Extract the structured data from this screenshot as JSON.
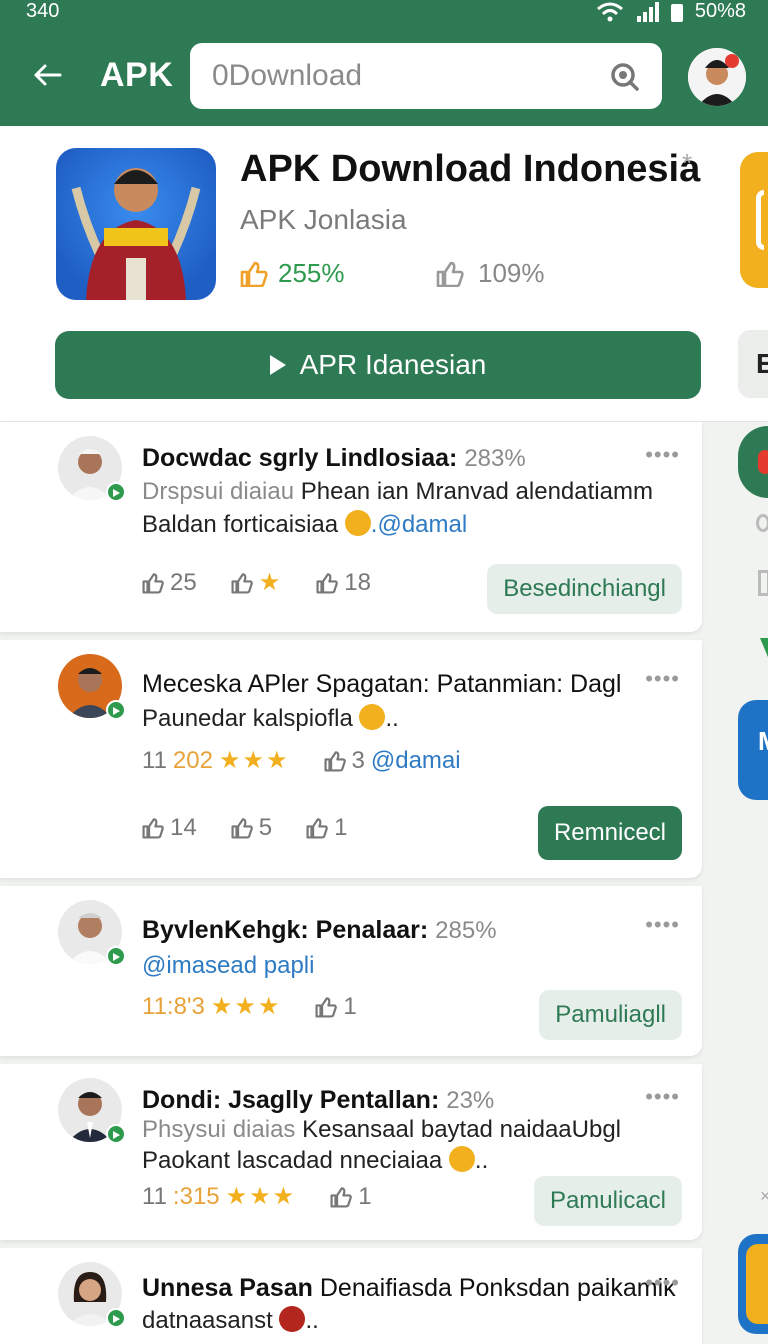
{
  "status": {
    "time": "340",
    "battery": "50%8"
  },
  "header": {
    "brand": "APK",
    "search_placeholder": "0Download"
  },
  "app": {
    "title": "APK Download Indonesia",
    "star": "*",
    "subtitle": "APK Jonlasia",
    "stat_likes": "255%",
    "stat_dislikes": "109%",
    "install_label": "APR Idanesian"
  },
  "peek": {
    "letter_b": "E",
    "letter_m": "M"
  },
  "reviews": [
    {
      "name": "Docwdac sgrly Lindlosiaa:",
      "pct": "283%",
      "line1_muted": "Drspsui diaiau",
      "line1": "Phean ian  Mranvad alendatiamm",
      "line2": "Baldan forticaisiaa",
      "mention": ".@damal",
      "likes": "25",
      "dislikes": "18",
      "action": "Besedinchiangl"
    },
    {
      "name": "Meceska APler Spagatan: Patanmian: Dagl",
      "line2": "Paunedar kalspiofla",
      "tail": "..",
      "num_prefix": "11",
      "num_orange": "202",
      "count": "3",
      "mention": "@damai",
      "likes": "14",
      "mid": "5",
      "dislikes": "1",
      "action": "Remnicecl"
    },
    {
      "name": "ByvlenKehgk: Penalaar:",
      "pct": "285%",
      "mention": "@imasead papli",
      "num": "11:8'3",
      "dislikes": "1",
      "action": "Pamuliagll"
    },
    {
      "name": "Dondi: Jsaglly Pentallan:",
      "pct": "23%",
      "line1_muted": "Phsysui diaias",
      "line1": "Kesansaal baytad naidaaUbgl",
      "line2": "Paokant lascadad nneciaiaa",
      "tail": "..",
      "num_prefix": "11",
      "num_orange": ":315",
      "dislikes": "1",
      "action": "Pamulicacl"
    },
    {
      "name": "Unnesa Pasan",
      "line1": "Denaifiasda Ponksdan paikamik",
      "line2": "datnaasanst",
      "tail": ".."
    }
  ],
  "dots": "••••",
  "colors": {
    "brand_green": "#2e7a55",
    "star": "#f2b01e",
    "mention": "#2e7bc4"
  }
}
